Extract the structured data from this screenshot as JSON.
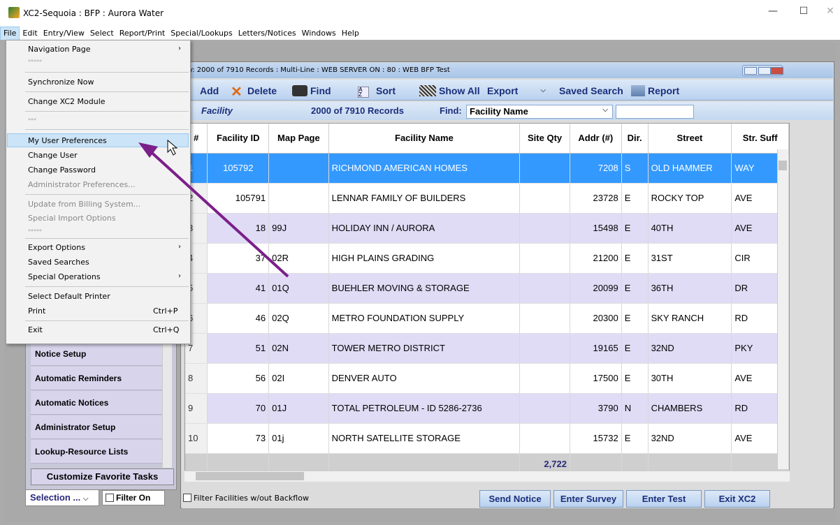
{
  "window": {
    "title": "XC2-Sequoia : BFP : Aurora Water",
    "minimize": "—",
    "maximize": "☐",
    "close": "✕"
  },
  "menubar": [
    "File",
    "Edit",
    "Entry/View",
    "Select",
    "Report/Print",
    "Special/Lookups",
    "Letters/Notices",
    "Windows",
    "Help"
  ],
  "file_menu": {
    "items": {
      "navigation_page": "Navigation Page",
      "stars1": "*****",
      "synchronize_now": "Synchronize Now",
      "change_module": "Change XC2 Module",
      "stars2": "***",
      "my_user_preferences": "My User Preferences",
      "change_user": "Change User",
      "change_password": "Change Password",
      "administrator_preferences": "Administrator Preferences...",
      "update_billing": "Update from Billing System...",
      "special_import": "Special Import Options",
      "stars3": "*****",
      "export_options": "Export Options",
      "saved_searches": "Saved Searches",
      "special_operations": "Special Operations",
      "select_printer": "Select Default Printer",
      "print": "Print",
      "print_shortcut": "Ctrl+P",
      "exit": "Exit",
      "exit_shortcut": "Ctrl+Q"
    }
  },
  "left_panel": {
    "tasks": [
      "Notice Setup",
      "Automatic Reminders",
      "Automatic Notices",
      "Administrator Setup",
      "Lookup-Resource Lists"
    ],
    "customize": "Customize Favorite Tasks",
    "selection": "Selection ...",
    "filter_on": "Filter On"
  },
  "grid_window": {
    "title": "y: 2000 of 7910 Records : Multi-Line : WEB SERVER ON : 80 : WEB BFP Test",
    "toolbar": {
      "add": "Add",
      "delete": "Delete",
      "find": "Find",
      "sort": "Sort",
      "show_all": "Show All",
      "export": "Export",
      "saved_search": "Saved Search",
      "report": "Report"
    },
    "findbar": {
      "entity": "Facility",
      "records": "2000 of 7910 Records",
      "find_label": "Find:",
      "find_field": "Facility Name"
    },
    "columns": [
      "#",
      "Facility ID",
      "Map Page",
      "Facility Name",
      "Site Qty",
      "Addr (#)",
      "Dir.",
      "Street",
      "Str. Suff"
    ],
    "rows": [
      {
        "n": "1",
        "id": "105792",
        "map": "",
        "name": "RICHMOND AMERICAN HOMES",
        "qty": "",
        "addr": "7208",
        "dir": "S",
        "street": "OLD HAMMER",
        "suff": "WAY"
      },
      {
        "n": "2",
        "id": "105791",
        "map": "",
        "name": "LENNAR FAMILY OF BUILDERS",
        "qty": "",
        "addr": "23728",
        "dir": "E",
        "street": "ROCKY TOP",
        "suff": "AVE"
      },
      {
        "n": "3",
        "id": "18",
        "map": "99J",
        "name": "HOLIDAY INN / AURORA",
        "qty": "",
        "addr": "15498",
        "dir": "E",
        "street": "40TH",
        "suff": "AVE"
      },
      {
        "n": "4",
        "id": "37",
        "map": "02R",
        "name": "HIGH PLAINS GRADING",
        "qty": "",
        "addr": "21200",
        "dir": "E",
        "street": "31ST",
        "suff": "CIR"
      },
      {
        "n": "5",
        "id": "41",
        "map": "01Q",
        "name": "BUEHLER MOVING & STORAGE",
        "qty": "",
        "addr": "20099",
        "dir": "E",
        "street": "36TH",
        "suff": "DR"
      },
      {
        "n": "6",
        "id": "46",
        "map": "02Q",
        "name": "METRO FOUNDATION SUPPLY",
        "qty": "",
        "addr": "20300",
        "dir": "E",
        "street": "SKY RANCH",
        "suff": "RD"
      },
      {
        "n": "7",
        "id": "51",
        "map": "02N",
        "name": "TOWER METRO DISTRICT",
        "qty": "",
        "addr": "19165",
        "dir": "E",
        "street": "32ND",
        "suff": "PKY"
      },
      {
        "n": "8",
        "id": "56",
        "map": "02I",
        "name": "DENVER AUTO",
        "qty": "",
        "addr": "17500",
        "dir": "E",
        "street": "30TH",
        "suff": "AVE"
      },
      {
        "n": "9",
        "id": "70",
        "map": "01J",
        "name": "TOTAL PETROLEUM - ID 5286-2736",
        "qty": "",
        "addr": "3790",
        "dir": "N",
        "street": "CHAMBERS",
        "suff": "RD"
      },
      {
        "n": "10",
        "id": "73",
        "map": "01j",
        "name": "NORTH SATELLITE STORAGE",
        "qty": "",
        "addr": "15732",
        "dir": "E",
        "street": "32ND",
        "suff": "AVE"
      }
    ],
    "total_site_qty": "2,722",
    "bottom": {
      "filter_backflow": "Filter Facilities w/out Backflow",
      "send_notice": "Send Notice",
      "enter_survey": "Enter Survey",
      "enter_test": "Enter Test",
      "exit": "Exit XC2"
    }
  },
  "colors": {
    "selected_row": "#3399ff",
    "alt_row": "#e0dcf6",
    "annotation_arrow": "#7b1f8a"
  }
}
